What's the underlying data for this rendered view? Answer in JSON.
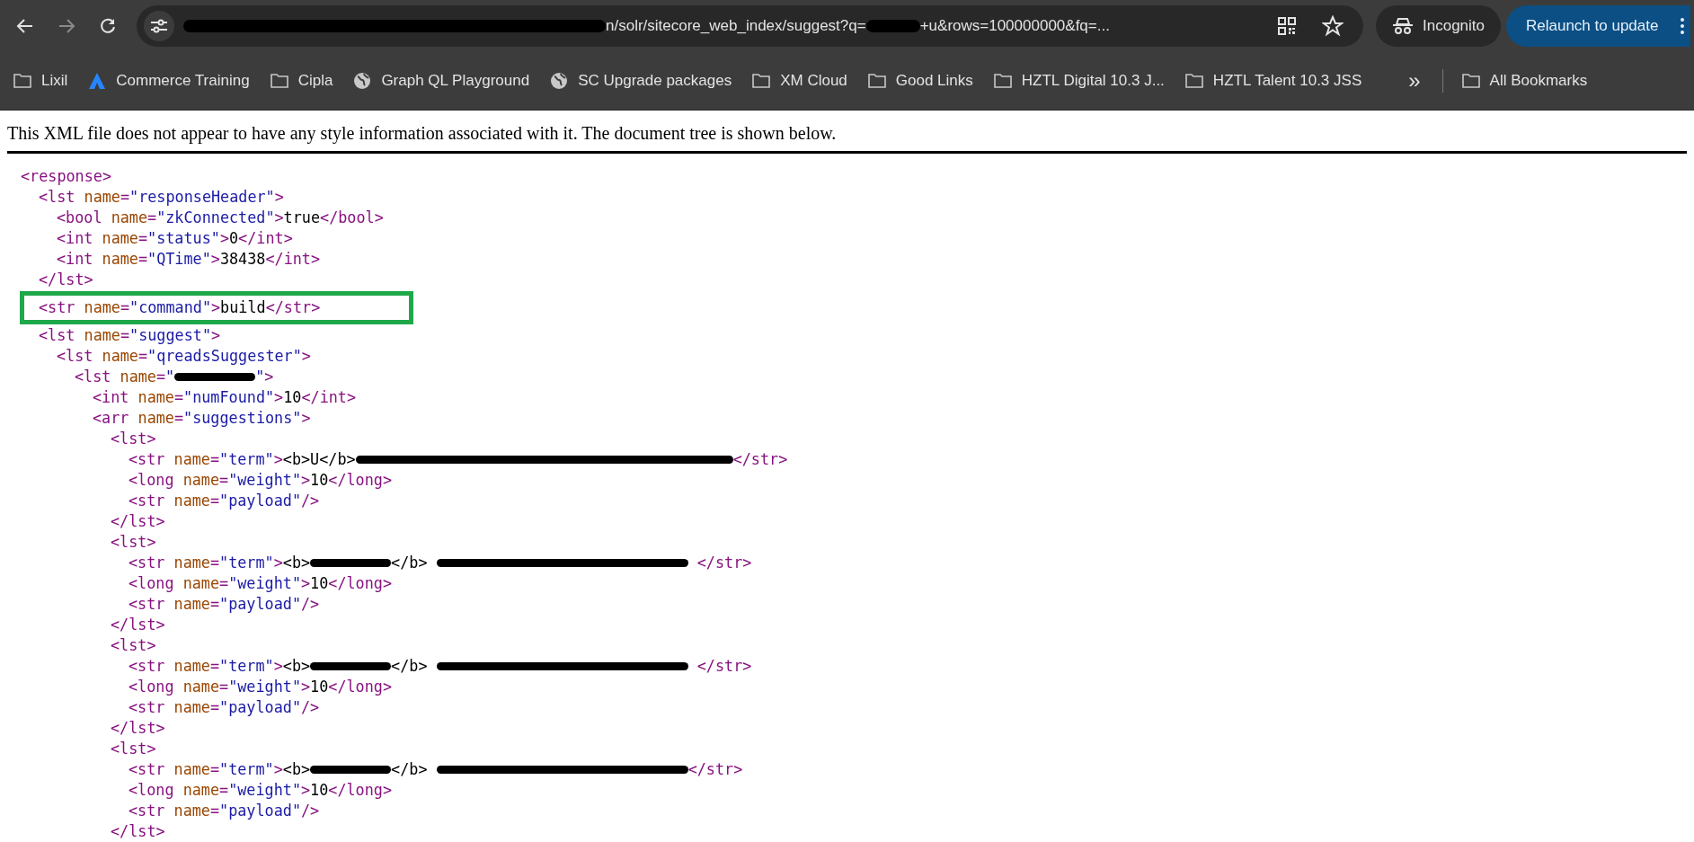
{
  "toolbar": {
    "url": [
      {
        "kind": "redaction_wide"
      },
      {
        "kind": "text",
        "text": "n/solr/sitecore_web_index/suggest?q="
      },
      {
        "kind": "redaction_short"
      },
      {
        "kind": "text",
        "text": "+u&rows=100000000&fq=..."
      }
    ],
    "profile": "Incognito",
    "update_button": "Relaunch to update"
  },
  "bookmarks": [
    {
      "kind": "folder",
      "label": "Lixil"
    },
    {
      "kind": "logo",
      "label": "Commerce Training"
    },
    {
      "kind": "folder",
      "label": "Cipla"
    },
    {
      "kind": "globe",
      "label": "Graph QL Playground"
    },
    {
      "kind": "globe",
      "label": "SC Upgrade packages"
    },
    {
      "kind": "folder",
      "label": "XM Cloud"
    },
    {
      "kind": "folder",
      "label": "Good Links"
    },
    {
      "kind": "folder",
      "label": "HZTL Digital 10.3 J..."
    },
    {
      "kind": "folder",
      "label": "HZTL Talent 10.3 JSS"
    }
  ],
  "bookmarks_more": "»",
  "all_bookmarks": "All Bookmarks",
  "notice": "This XML file does not appear to have any style information associated with it. The document tree is shown below.",
  "tree": [
    {
      "tokens": [
        {
          "kind": "tag",
          "text": "<response>"
        }
      ],
      "children": [
        {
          "tokens": [
            {
              "kind": "tag",
              "text": "<lst "
            },
            {
              "kind": "attr",
              "text": "name"
            },
            {
              "kind": "tag",
              "text": "="
            },
            {
              "kind": "value",
              "text": "\"responseHeader\""
            },
            {
              "kind": "tag",
              "text": ">"
            }
          ],
          "children": [
            {
              "tokens": [
                {
                  "kind": "tag",
                  "text": "<bool "
                },
                {
                  "kind": "attr",
                  "text": "name"
                },
                {
                  "kind": "tag",
                  "text": "="
                },
                {
                  "kind": "value",
                  "text": "\"zkConnected\""
                },
                {
                  "kind": "tag",
                  "text": ">"
                },
                {
                  "kind": "text",
                  "text": "true"
                },
                {
                  "kind": "tag",
                  "text": "</bool>"
                }
              ]
            },
            {
              "tokens": [
                {
                  "kind": "tag",
                  "text": "<int "
                },
                {
                  "kind": "attr",
                  "text": "name"
                },
                {
                  "kind": "tag",
                  "text": "="
                },
                {
                  "kind": "value",
                  "text": "\"status\""
                },
                {
                  "kind": "tag",
                  "text": ">"
                },
                {
                  "kind": "text",
                  "text": "0"
                },
                {
                  "kind": "tag",
                  "text": "</int>"
                }
              ]
            },
            {
              "tokens": [
                {
                  "kind": "tag",
                  "text": "<int "
                },
                {
                  "kind": "attr",
                  "text": "name"
                },
                {
                  "kind": "tag",
                  "text": "="
                },
                {
                  "kind": "value",
                  "text": "\"QTime\""
                },
                {
                  "kind": "tag",
                  "text": ">"
                },
                {
                  "kind": "text",
                  "text": "38438"
                },
                {
                  "kind": "tag",
                  "text": "</int>"
                }
              ]
            }
          ]
        },
        {
          "tokens": [
            {
              "kind": "tag",
              "text": "</lst>"
            }
          ]
        },
        {
          "highlighted": true,
          "tokens": [
            {
              "kind": "tag",
              "text": "<str "
            },
            {
              "kind": "attr",
              "text": "name"
            },
            {
              "kind": "tag",
              "text": "="
            },
            {
              "kind": "value",
              "text": "\"command\""
            },
            {
              "kind": "tag",
              "text": ">"
            },
            {
              "kind": "text",
              "text": "build"
            },
            {
              "kind": "tag",
              "text": "</str>"
            }
          ]
        },
        {
          "tokens": [
            {
              "kind": "tag",
              "text": "<lst "
            },
            {
              "kind": "attr",
              "text": "name"
            },
            {
              "kind": "tag",
              "text": "="
            },
            {
              "kind": "value",
              "text": "\"suggest\""
            },
            {
              "kind": "tag",
              "text": ">"
            }
          ],
          "children": [
            {
              "tokens": [
                {
                  "kind": "tag",
                  "text": "<lst "
                },
                {
                  "kind": "attr",
                  "text": "name"
                },
                {
                  "kind": "tag",
                  "text": "="
                },
                {
                  "kind": "value",
                  "text": "\"qreadsSuggester\""
                },
                {
                  "kind": "tag",
                  "text": ">"
                }
              ],
              "children": [
                {
                  "tokens": [
                    {
                      "kind": "tag",
                      "text": "<lst "
                    },
                    {
                      "kind": "attr",
                      "text": "name"
                    },
                    {
                      "kind": "tag",
                      "text": "="
                    },
                    {
                      "kind": "value",
                      "text": "\""
                    },
                    {
                      "kind": "redaction_short"
                    },
                    {
                      "kind": "value",
                      "text": "\""
                    },
                    {
                      "kind": "tag",
                      "text": ">"
                    }
                  ],
                  "children": [
                    {
                      "tokens": [
                        {
                          "kind": "tag",
                          "text": "<int "
                        },
                        {
                          "kind": "attr",
                          "text": "name"
                        },
                        {
                          "kind": "tag",
                          "text": "="
                        },
                        {
                          "kind": "value",
                          "text": "\"numFound\""
                        },
                        {
                          "kind": "tag",
                          "text": ">"
                        },
                        {
                          "kind": "text",
                          "text": "10"
                        },
                        {
                          "kind": "tag",
                          "text": "</int>"
                        }
                      ]
                    },
                    {
                      "tokens": [
                        {
                          "kind": "tag",
                          "text": "<arr "
                        },
                        {
                          "kind": "attr",
                          "text": "name"
                        },
                        {
                          "kind": "tag",
                          "text": "="
                        },
                        {
                          "kind": "value",
                          "text": "\"suggestions\""
                        },
                        {
                          "kind": "tag",
                          "text": ">"
                        }
                      ],
                      "children": [
                        {
                          "tokens": [
                            {
                              "kind": "tag",
                              "text": "<lst>"
                            }
                          ],
                          "children": [
                            {
                              "tokens": [
                                {
                                  "kind": "tag",
                                  "text": "<str "
                                },
                                {
                                  "kind": "attr",
                                  "text": "name"
                                },
                                {
                                  "kind": "tag",
                                  "text": "="
                                },
                                {
                                  "kind": "value",
                                  "text": "\"term\""
                                },
                                {
                                  "kind": "tag",
                                  "text": ">"
                                },
                                {
                                  "kind": "text",
                                  "text": "<b>U</b>"
                                },
                                {
                                  "kind": "redaction_wide"
                                },
                                {
                                  "kind": "tag",
                                  "text": "</str>"
                                }
                              ]
                            },
                            {
                              "tokens": [
                                {
                                  "kind": "tag",
                                  "text": "<long "
                                },
                                {
                                  "kind": "attr",
                                  "text": "name"
                                },
                                {
                                  "kind": "tag",
                                  "text": "="
                                },
                                {
                                  "kind": "value",
                                  "text": "\"weight\""
                                },
                                {
                                  "kind": "tag",
                                  "text": ">"
                                },
                                {
                                  "kind": "text",
                                  "text": "10"
                                },
                                {
                                  "kind": "tag",
                                  "text": "</long>"
                                }
                              ]
                            },
                            {
                              "tokens": [
                                {
                                  "kind": "tag",
                                  "text": "<str "
                                },
                                {
                                  "kind": "attr",
                                  "text": "name"
                                },
                                {
                                  "kind": "tag",
                                  "text": "="
                                },
                                {
                                  "kind": "value",
                                  "text": "\"payload\""
                                },
                                {
                                  "kind": "tag",
                                  "text": "/>"
                                }
                              ]
                            }
                          ]
                        },
                        {
                          "tokens": [
                            {
                              "kind": "tag",
                              "text": "</lst>"
                            }
                          ]
                        },
                        {
                          "tokens": [
                            {
                              "kind": "tag",
                              "text": "<lst>"
                            }
                          ],
                          "children": [
                            {
                              "tokens": [
                                {
                                  "kind": "tag",
                                  "text": "<str "
                                },
                                {
                                  "kind": "attr",
                                  "text": "name"
                                },
                                {
                                  "kind": "tag",
                                  "text": "="
                                },
                                {
                                  "kind": "value",
                                  "text": "\"term\""
                                },
                                {
                                  "kind": "tag",
                                  "text": ">"
                                },
                                {
                                  "kind": "text",
                                  "text": "<b>"
                                },
                                {
                                  "kind": "redaction_short"
                                },
                                {
                                  "kind": "text",
                                  "text": "</b> "
                                },
                                {
                                  "kind": "redaction_long"
                                },
                                {
                                  "kind": "tag",
                                  "text": " </str>"
                                }
                              ]
                            },
                            {
                              "tokens": [
                                {
                                  "kind": "tag",
                                  "text": "<long "
                                },
                                {
                                  "kind": "attr",
                                  "text": "name"
                                },
                                {
                                  "kind": "tag",
                                  "text": "="
                                },
                                {
                                  "kind": "value",
                                  "text": "\"weight\""
                                },
                                {
                                  "kind": "tag",
                                  "text": ">"
                                },
                                {
                                  "kind": "text",
                                  "text": "10"
                                },
                                {
                                  "kind": "tag",
                                  "text": "</long>"
                                }
                              ]
                            },
                            {
                              "tokens": [
                                {
                                  "kind": "tag",
                                  "text": "<str "
                                },
                                {
                                  "kind": "attr",
                                  "text": "name"
                                },
                                {
                                  "kind": "tag",
                                  "text": "="
                                },
                                {
                                  "kind": "value",
                                  "text": "\"payload\""
                                },
                                {
                                  "kind": "tag",
                                  "text": "/>"
                                }
                              ]
                            }
                          ]
                        },
                        {
                          "tokens": [
                            {
                              "kind": "tag",
                              "text": "</lst>"
                            }
                          ]
                        },
                        {
                          "tokens": [
                            {
                              "kind": "tag",
                              "text": "<lst>"
                            }
                          ],
                          "children": [
                            {
                              "tokens": [
                                {
                                  "kind": "tag",
                                  "text": "<str "
                                },
                                {
                                  "kind": "attr",
                                  "text": "name"
                                },
                                {
                                  "kind": "tag",
                                  "text": "="
                                },
                                {
                                  "kind": "value",
                                  "text": "\"term\""
                                },
                                {
                                  "kind": "tag",
                                  "text": ">"
                                },
                                {
                                  "kind": "text",
                                  "text": "<b>"
                                },
                                {
                                  "kind": "redaction_short"
                                },
                                {
                                  "kind": "text",
                                  "text": "</b> "
                                },
                                {
                                  "kind": "redaction_long"
                                },
                                {
                                  "kind": "tag",
                                  "text": " </str>"
                                }
                              ]
                            },
                            {
                              "tokens": [
                                {
                                  "kind": "tag",
                                  "text": "<long "
                                },
                                {
                                  "kind": "attr",
                                  "text": "name"
                                },
                                {
                                  "kind": "tag",
                                  "text": "="
                                },
                                {
                                  "kind": "value",
                                  "text": "\"weight\""
                                },
                                {
                                  "kind": "tag",
                                  "text": ">"
                                },
                                {
                                  "kind": "text",
                                  "text": "10"
                                },
                                {
                                  "kind": "tag",
                                  "text": "</long>"
                                }
                              ]
                            },
                            {
                              "tokens": [
                                {
                                  "kind": "tag",
                                  "text": "<str "
                                },
                                {
                                  "kind": "attr",
                                  "text": "name"
                                },
                                {
                                  "kind": "tag",
                                  "text": "="
                                },
                                {
                                  "kind": "value",
                                  "text": "\"payload\""
                                },
                                {
                                  "kind": "tag",
                                  "text": "/>"
                                }
                              ]
                            }
                          ]
                        },
                        {
                          "tokens": [
                            {
                              "kind": "tag",
                              "text": "</lst>"
                            }
                          ]
                        },
                        {
                          "tokens": [
                            {
                              "kind": "tag",
                              "text": "<lst>"
                            }
                          ],
                          "children": [
                            {
                              "tokens": [
                                {
                                  "kind": "tag",
                                  "text": "<str "
                                },
                                {
                                  "kind": "attr",
                                  "text": "name"
                                },
                                {
                                  "kind": "tag",
                                  "text": "="
                                },
                                {
                                  "kind": "value",
                                  "text": "\"term\""
                                },
                                {
                                  "kind": "tag",
                                  "text": ">"
                                },
                                {
                                  "kind": "text",
                                  "text": "<b>"
                                },
                                {
                                  "kind": "redaction_short"
                                },
                                {
                                  "kind": "text",
                                  "text": "</b> "
                                },
                                {
                                  "kind": "redaction_long"
                                },
                                {
                                  "kind": "tag",
                                  "text": "</str>"
                                }
                              ]
                            },
                            {
                              "tokens": [
                                {
                                  "kind": "tag",
                                  "text": "<long "
                                },
                                {
                                  "kind": "attr",
                                  "text": "name"
                                },
                                {
                                  "kind": "tag",
                                  "text": "="
                                },
                                {
                                  "kind": "value",
                                  "text": "\"weight\""
                                },
                                {
                                  "kind": "tag",
                                  "text": ">"
                                },
                                {
                                  "kind": "text",
                                  "text": "10"
                                },
                                {
                                  "kind": "tag",
                                  "text": "</long>"
                                }
                              ]
                            },
                            {
                              "tokens": [
                                {
                                  "kind": "tag",
                                  "text": "<str "
                                },
                                {
                                  "kind": "attr",
                                  "text": "name"
                                },
                                {
                                  "kind": "tag",
                                  "text": "="
                                },
                                {
                                  "kind": "value",
                                  "text": "\"payload\""
                                },
                                {
                                  "kind": "tag",
                                  "text": "/>"
                                }
                              ]
                            }
                          ]
                        },
                        {
                          "tokens": [
                            {
                              "kind": "tag",
                              "text": "</lst>"
                            }
                          ]
                        }
                      ]
                    }
                  ]
                }
              ]
            }
          ]
        }
      ]
    }
  ]
}
